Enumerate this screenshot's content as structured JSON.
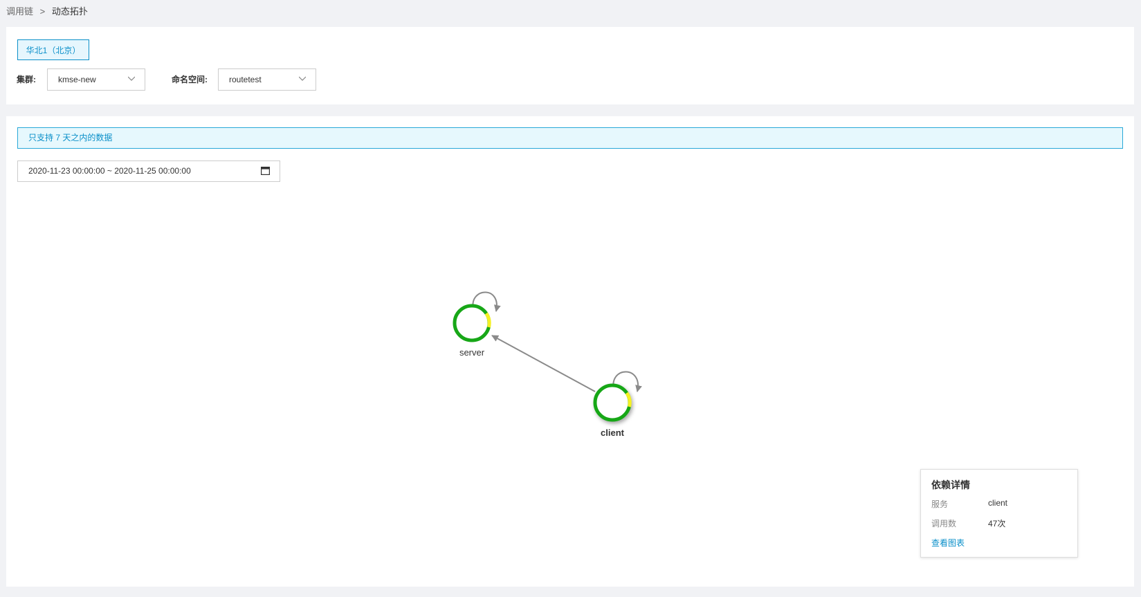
{
  "breadcrumb": {
    "parent": "调用链",
    "separator": ">",
    "current": "动态拓扑"
  },
  "region": {
    "label": "华北1（北京）"
  },
  "filters": {
    "cluster_label": "集群:",
    "cluster_value": "kmse-new",
    "namespace_label": "命名空间:",
    "namespace_value": "routetest"
  },
  "notice": {
    "text": "只支持 7 天之内的数据"
  },
  "date_range": {
    "value": "2020-11-23 00:00:00 ~ 2020-11-25 00:00:00"
  },
  "topology": {
    "nodes": [
      {
        "name": "server"
      },
      {
        "name": "client"
      }
    ],
    "edges": [
      {
        "from": "client",
        "to": "server"
      },
      {
        "from": "server",
        "to": "server"
      },
      {
        "from": "client",
        "to": "client"
      }
    ]
  },
  "detail": {
    "title": "依赖详情",
    "service_label": "服务",
    "service_value": "client",
    "calls_label": "调用数",
    "calls_value": "47次",
    "link": "查看图表"
  },
  "colors": {
    "accent": "#0a8fc9",
    "node_ok": "#17a717",
    "node_warn": "#f5f024",
    "edge": "#8a8a8a"
  }
}
